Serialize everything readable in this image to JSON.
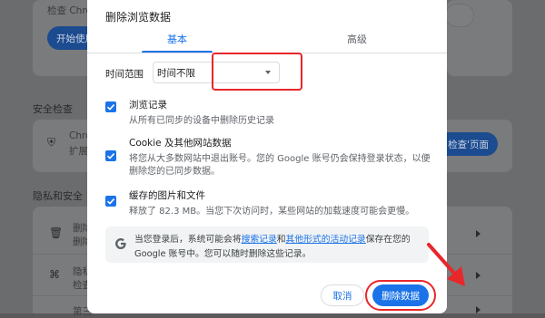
{
  "background": {
    "check_text": "检查 Chrom",
    "start_button": "开始使用",
    "safety_heading": "安全检查",
    "chrome_row_title": "Chrom",
    "chrome_row_sub": "扩展程",
    "go_check_button": "检查'页面",
    "privacy_heading": "隐私和安全",
    "row1_title": "删除",
    "row1_sub": "删除",
    "row2_title": "隐私",
    "row2_sub": "检查",
    "row3_title": "第三"
  },
  "dialog": {
    "title": "删除浏览数据",
    "tabs": [
      {
        "label": "基本",
        "active": true
      },
      {
        "label": "高级",
        "active": false
      }
    ],
    "time_range_label": "时间范围",
    "time_range_value": "时间不限",
    "options": [
      {
        "title": "浏览记录",
        "desc": "从所有已同步的设备中删除历史记录",
        "desc2": "",
        "checked": true
      },
      {
        "title": "Cookie 及其他网站数据",
        "desc": "将您从大多数网站中退出账号。您的 Google 账号仍会保持登录状态，以便",
        "desc2": "删除您的已同步数据。",
        "checked": true
      },
      {
        "title": "缓存的图片和文件",
        "desc": "释放了 82.3 MB。当您下次访问时，某些网站的加载速度可能会更慢。",
        "desc2": "",
        "checked": true
      }
    ],
    "info": {
      "part1": "当您登录后，系统可能会将",
      "link1": "搜索记录",
      "part2": "和",
      "link2": "其他形式的活动记录",
      "part3": "保存在您的",
      "line2": "Google 账号中。您可以随时删除这些记录。"
    },
    "cancel_label": "取消",
    "delete_label": "删除数据"
  },
  "colors": {
    "accent": "#1a73e8",
    "annotation_red": "#e8272b"
  }
}
